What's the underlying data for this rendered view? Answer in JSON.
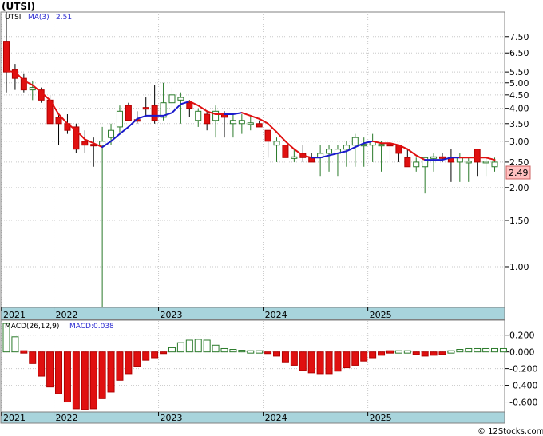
{
  "chart_data": [
    {
      "type": "candlestick",
      "title": "(UTSI)",
      "legend": {
        "symbol": "UTSI",
        "ma_label": "MA(3)",
        "ma_value": "2.51"
      },
      "y_scale": "log",
      "ylim": [
        0.7,
        9.3
      ],
      "y_ticks": [
        "7.50",
        "6.50",
        "5.50",
        "5.00",
        "4.50",
        "4.00",
        "3.50",
        "3.00",
        "2.50",
        "2.00",
        "1.50",
        "1.00"
      ],
      "x_tick_labels": [
        "2021",
        "2022",
        "2023",
        "2024",
        "2025"
      ],
      "last_price": "2.49",
      "candles": [
        {
          "o": 7.2,
          "h": 9.3,
          "l": 4.6,
          "c": 5.5,
          "up": false
        },
        {
          "o": 5.6,
          "h": 5.9,
          "l": 4.7,
          "c": 5.2,
          "up": false
        },
        {
          "o": 5.2,
          "h": 5.4,
          "l": 4.6,
          "c": 4.7,
          "up": false
        },
        {
          "o": 4.8,
          "h": 5.1,
          "l": 4.3,
          "c": 4.7,
          "up": true
        },
        {
          "o": 4.7,
          "h": 4.8,
          "l": 4.2,
          "c": 4.3,
          "up": false
        },
        {
          "o": 4.3,
          "h": 4.5,
          "l": 3.5,
          "c": 3.5,
          "up": false
        },
        {
          "o": 3.7,
          "h": 3.8,
          "l": 2.9,
          "c": 3.5,
          "up": false
        },
        {
          "o": 3.5,
          "h": 3.8,
          "l": 3.2,
          "c": 3.3,
          "up": false
        },
        {
          "o": 3.4,
          "h": 3.5,
          "l": 2.7,
          "c": 2.8,
          "up": false
        },
        {
          "o": 3.0,
          "h": 3.3,
          "l": 2.7,
          "c": 2.9,
          "up": false
        },
        {
          "o": 2.9,
          "h": 3.1,
          "l": 2.4,
          "c": 2.9,
          "up": false
        },
        {
          "o": 2.9,
          "h": 3.4,
          "l": 0.7,
          "c": 3.0,
          "up": true
        },
        {
          "o": 3.1,
          "h": 3.5,
          "l": 2.9,
          "c": 3.3,
          "up": true
        },
        {
          "o": 3.4,
          "h": 4.1,
          "l": 3.2,
          "c": 3.9,
          "up": true
        },
        {
          "o": 4.1,
          "h": 4.2,
          "l": 3.6,
          "c": 3.6,
          "up": false
        },
        {
          "o": 3.6,
          "h": 3.9,
          "l": 3.5,
          "c": 3.6,
          "up": false
        },
        {
          "o": 4.0,
          "h": 4.4,
          "l": 3.7,
          "c": 4.0,
          "up": false
        },
        {
          "o": 4.1,
          "h": 4.9,
          "l": 3.5,
          "c": 3.6,
          "up": false
        },
        {
          "o": 3.7,
          "h": 5.0,
          "l": 3.6,
          "c": 4.2,
          "up": true
        },
        {
          "o": 4.2,
          "h": 4.8,
          "l": 4.0,
          "c": 4.5,
          "up": true
        },
        {
          "o": 4.4,
          "h": 4.6,
          "l": 3.5,
          "c": 4.3,
          "up": true
        },
        {
          "o": 4.2,
          "h": 4.3,
          "l": 3.7,
          "c": 4.0,
          "up": false
        },
        {
          "o": 3.6,
          "h": 4.0,
          "l": 3.4,
          "c": 3.9,
          "up": true
        },
        {
          "o": 3.8,
          "h": 3.9,
          "l": 3.3,
          "c": 3.5,
          "up": false
        },
        {
          "o": 3.6,
          "h": 4.1,
          "l": 3.1,
          "c": 3.9,
          "up": true
        },
        {
          "o": 3.8,
          "h": 3.9,
          "l": 3.1,
          "c": 3.7,
          "up": false
        },
        {
          "o": 3.6,
          "h": 3.8,
          "l": 3.1,
          "c": 3.5,
          "up": true
        },
        {
          "o": 3.6,
          "h": 3.8,
          "l": 3.2,
          "c": 3.5,
          "up": true
        },
        {
          "o": 3.5,
          "h": 3.7,
          "l": 3.3,
          "c": 3.5,
          "up": true
        },
        {
          "o": 3.5,
          "h": 3.6,
          "l": 3.4,
          "c": 3.4,
          "up": false
        },
        {
          "o": 3.3,
          "h": 3.3,
          "l": 2.6,
          "c": 3.0,
          "up": false
        },
        {
          "o": 2.9,
          "h": 3.1,
          "l": 2.5,
          "c": 3.0,
          "up": true
        },
        {
          "o": 2.9,
          "h": 2.9,
          "l": 2.6,
          "c": 2.6,
          "up": false
        },
        {
          "o": 2.6,
          "h": 2.8,
          "l": 2.5,
          "c": 2.6,
          "up": true
        },
        {
          "o": 2.7,
          "h": 2.9,
          "l": 2.5,
          "c": 2.6,
          "up": false
        },
        {
          "o": 2.6,
          "h": 2.7,
          "l": 2.5,
          "c": 2.5,
          "up": false
        },
        {
          "o": 2.6,
          "h": 2.9,
          "l": 2.2,
          "c": 2.7,
          "up": true
        },
        {
          "o": 2.7,
          "h": 2.9,
          "l": 2.3,
          "c": 2.8,
          "up": true
        },
        {
          "o": 2.7,
          "h": 2.9,
          "l": 2.2,
          "c": 2.8,
          "up": true
        },
        {
          "o": 2.8,
          "h": 3.0,
          "l": 2.4,
          "c": 2.9,
          "up": true
        },
        {
          "o": 2.9,
          "h": 3.2,
          "l": 2.4,
          "c": 3.1,
          "up": true
        },
        {
          "o": 2.9,
          "h": 3.1,
          "l": 2.4,
          "c": 2.9,
          "up": true
        },
        {
          "o": 2.9,
          "h": 3.2,
          "l": 2.5,
          "c": 3.0,
          "up": true
        },
        {
          "o": 2.9,
          "h": 3.0,
          "l": 2.3,
          "c": 2.9,
          "up": true
        },
        {
          "o": 2.9,
          "h": 2.9,
          "l": 2.5,
          "c": 2.9,
          "up": false
        },
        {
          "o": 2.9,
          "h": 2.9,
          "l": 2.5,
          "c": 2.7,
          "up": false
        },
        {
          "o": 2.6,
          "h": 2.8,
          "l": 2.4,
          "c": 2.4,
          "up": false
        },
        {
          "o": 2.4,
          "h": 2.6,
          "l": 2.3,
          "c": 2.5,
          "up": true
        },
        {
          "o": 2.4,
          "h": 2.6,
          "l": 1.9,
          "c": 2.6,
          "up": true
        },
        {
          "o": 2.6,
          "h": 2.7,
          "l": 2.3,
          "c": 2.6,
          "up": true
        },
        {
          "o": 2.6,
          "h": 2.7,
          "l": 2.5,
          "c": 2.6,
          "up": false
        },
        {
          "o": 2.6,
          "h": 2.8,
          "l": 2.1,
          "c": 2.5,
          "up": false
        },
        {
          "o": 2.5,
          "h": 2.7,
          "l": 2.1,
          "c": 2.6,
          "up": true
        },
        {
          "o": 2.5,
          "h": 2.6,
          "l": 2.1,
          "c": 2.5,
          "up": true
        },
        {
          "o": 2.8,
          "h": 2.8,
          "l": 2.2,
          "c": 2.5,
          "up": false
        },
        {
          "o": 2.5,
          "h": 2.6,
          "l": 2.2,
          "c": 2.5,
          "up": true
        },
        {
          "o": 2.4,
          "h": 2.6,
          "l": 2.3,
          "c": 2.5,
          "up": true
        }
      ],
      "ma": [
        5.55,
        5.5,
        5.1,
        4.9,
        4.6,
        4.3,
        3.8,
        3.5,
        3.3,
        3.05,
        2.95,
        2.85,
        3.0,
        3.2,
        3.4,
        3.65,
        3.75,
        3.75,
        3.75,
        3.85,
        4.15,
        4.25,
        4.1,
        3.9,
        3.8,
        3.8,
        3.8,
        3.85,
        3.75,
        3.65,
        3.5,
        3.25,
        3.0,
        2.8,
        2.65,
        2.6,
        2.6,
        2.65,
        2.7,
        2.75,
        2.85,
        2.95,
        3.0,
        2.95,
        2.95,
        2.9,
        2.8,
        2.65,
        2.55,
        2.55,
        2.55,
        2.6,
        2.6,
        2.6,
        2.6,
        2.6,
        2.55,
        2.5
      ],
      "ma_trend": [
        "down",
        "down",
        "down",
        "down",
        "down",
        "down",
        "down",
        "down",
        "down",
        "down",
        "down",
        "down",
        "up",
        "up",
        "up",
        "up",
        "up",
        "up",
        "up",
        "up",
        "up",
        "up",
        "down",
        "down",
        "down",
        "down",
        "up",
        "up",
        "down",
        "down",
        "down",
        "down",
        "down",
        "down",
        "down",
        "down",
        "up",
        "up",
        "up",
        "up",
        "up",
        "up",
        "up",
        "down",
        "down",
        "down",
        "down",
        "down",
        "down",
        "up",
        "up",
        "up",
        "up",
        "down",
        "down",
        "down",
        "down",
        "down"
      ]
    },
    {
      "type": "bar",
      "title": "MACD(26,12,9)",
      "legend": {
        "label": "MACD(26,12,9)",
        "value_label": "MACD:0.038"
      },
      "ylim": [
        -0.7,
        0.35
      ],
      "y_ticks": [
        "0.200",
        "0.000",
        "-0.200",
        "-0.400",
        "-0.600"
      ],
      "x_tick_labels": [
        "2021",
        "2022",
        "2023",
        "2024",
        "2025"
      ],
      "values": [
        0.34,
        0.18,
        -0.01,
        -0.14,
        -0.29,
        -0.42,
        -0.5,
        -0.6,
        -0.68,
        -0.69,
        -0.68,
        -0.56,
        -0.48,
        -0.34,
        -0.26,
        -0.17,
        -0.1,
        -0.07,
        -0.02,
        0.05,
        0.11,
        0.14,
        0.15,
        0.14,
        0.08,
        0.04,
        0.03,
        0.02,
        0.01,
        0.0,
        -0.02,
        -0.05,
        -0.12,
        -0.16,
        -0.22,
        -0.25,
        -0.26,
        -0.26,
        -0.23,
        -0.19,
        -0.16,
        -0.11,
        -0.07,
        -0.04,
        -0.01,
        0.0,
        0.0,
        -0.03,
        -0.05,
        -0.04,
        -0.03,
        0.0,
        0.03,
        0.04,
        0.04,
        0.04,
        0.04,
        0.04
      ],
      "x_tick_positions": [
        0,
        6,
        18,
        30,
        42
      ]
    }
  ],
  "footer": {
    "credit": "© 12Stocks.com"
  }
}
